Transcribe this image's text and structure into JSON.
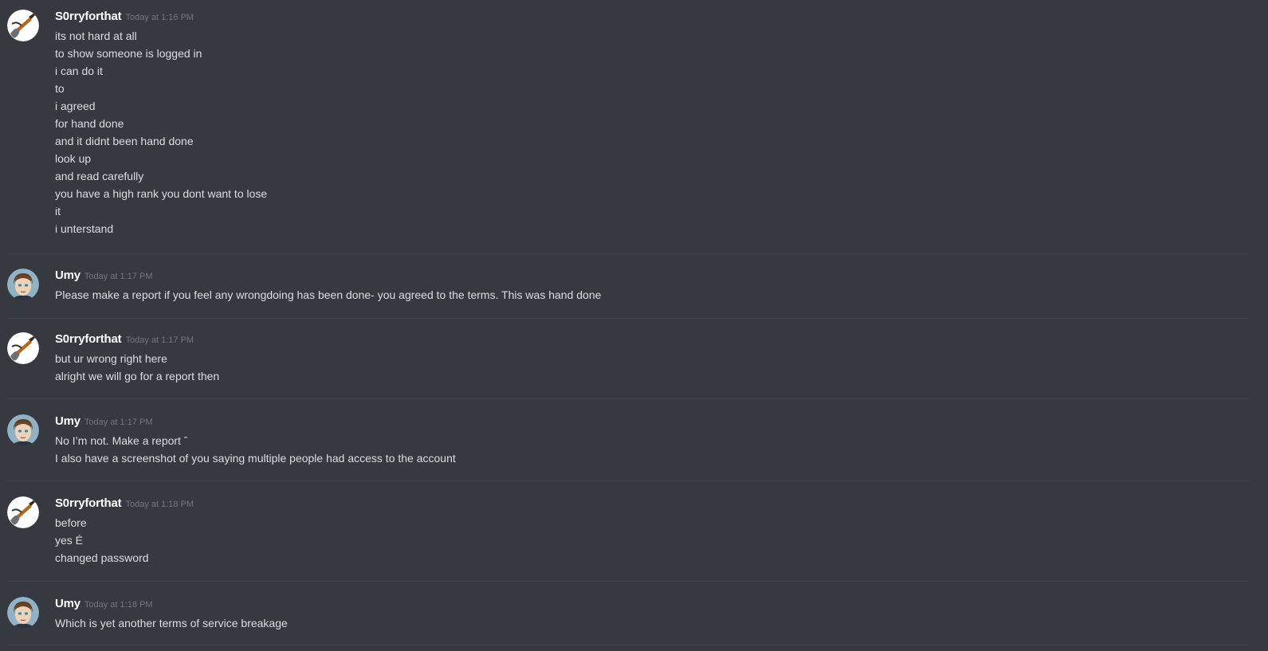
{
  "messages": [
    {
      "username": "S0rryforthat",
      "timestamp": "Today at 1:16 PM",
      "avatar_icon": "guitar-avatar-icon",
      "lines": [
        "its not hard at all",
        "to show someone is logged in",
        "i can do it",
        "to",
        "i agreed",
        "for hand done",
        "and it didnt been hand done",
        "look up",
        "and read carefully",
        "you have a high rank you dont want to lose",
        "it",
        "i unterstand"
      ]
    },
    {
      "username": "Umy",
      "timestamp": "Today at 1:17 PM",
      "avatar_icon": "anime-man-avatar-icon",
      "lines": [
        "Please make a report if you feel any wrongdoing has been done- you agreed to the terms. This was hand done"
      ]
    },
    {
      "username": "S0rryforthat",
      "timestamp": "Today at 1:17 PM",
      "avatar_icon": "guitar-avatar-icon",
      "lines": [
        "but ur wrong right here",
        "alright we will go for a report then"
      ]
    },
    {
      "username": "Umy",
      "timestamp": "Today at 1:17 PM",
      "avatar_icon": "anime-man-avatar-icon",
      "lines": [
        "No I’m not. Make a report ˆ",
        "I also have a screenshot of you saying multiple people had access to the account"
      ]
    },
    {
      "username": "S0rryforthat",
      "timestamp": "Today at 1:18 PM",
      "avatar_icon": "guitar-avatar-icon",
      "lines": [
        "before",
        "yes É",
        "changed password"
      ]
    },
    {
      "username": "Umy",
      "timestamp": "Today at 1:18 PM",
      "avatar_icon": "anime-man-avatar-icon",
      "lines": [
        "Which is yet another terms of service breakage"
      ]
    }
  ]
}
